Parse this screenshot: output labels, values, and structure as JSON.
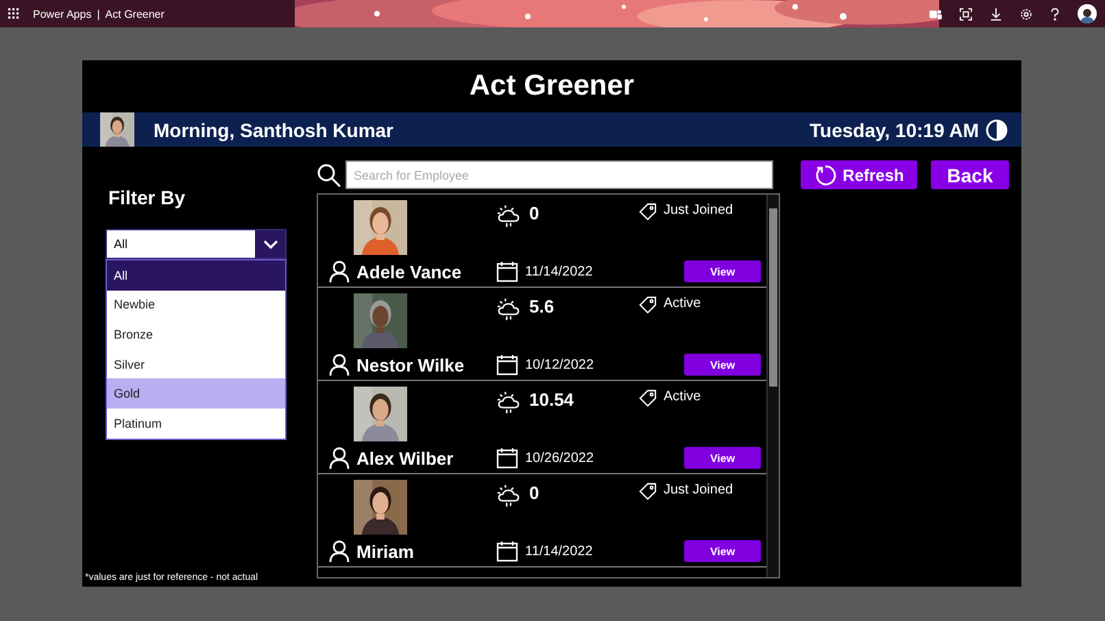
{
  "top_bar": {
    "app_name": "Power Apps",
    "separator": "|",
    "title": "Act Greener"
  },
  "app": {
    "title": "Act Greener",
    "greeting": "Morning, Santhosh Kumar",
    "datetime": "Tuesday, 10:19 AM"
  },
  "filter": {
    "label": "Filter By",
    "value": "All",
    "options": [
      {
        "label": "All",
        "selected": true,
        "highlighted": false
      },
      {
        "label": "Newbie",
        "selected": false,
        "highlighted": false
      },
      {
        "label": "Bronze",
        "selected": false,
        "highlighted": false
      },
      {
        "label": "Silver",
        "selected": false,
        "highlighted": false
      },
      {
        "label": "Gold",
        "selected": false,
        "highlighted": true
      },
      {
        "label": "Platinum",
        "selected": false,
        "highlighted": false
      }
    ]
  },
  "search": {
    "placeholder": "Search for Employee"
  },
  "buttons": [
    {
      "label": "Refresh",
      "kind": "refresh"
    },
    {
      "label": "Back",
      "kind": "plain"
    }
  ],
  "employees": [
    {
      "name": "Adele Vance",
      "score": "0",
      "status": "Just Joined",
      "date": "11/14/2022",
      "action": "View"
    },
    {
      "name": "Nestor Wilke",
      "score": "5.6",
      "status": "Active",
      "date": "10/12/2022",
      "action": "View"
    },
    {
      "name": "Alex Wilber",
      "score": "10.54",
      "status": "Active",
      "date": "10/26/2022",
      "action": "View"
    },
    {
      "name": "Miriam",
      "score": "0",
      "status": "Just Joined",
      "date": "11/14/2022",
      "action": "View"
    }
  ],
  "footnote": "*values are just for reference - not actual"
}
